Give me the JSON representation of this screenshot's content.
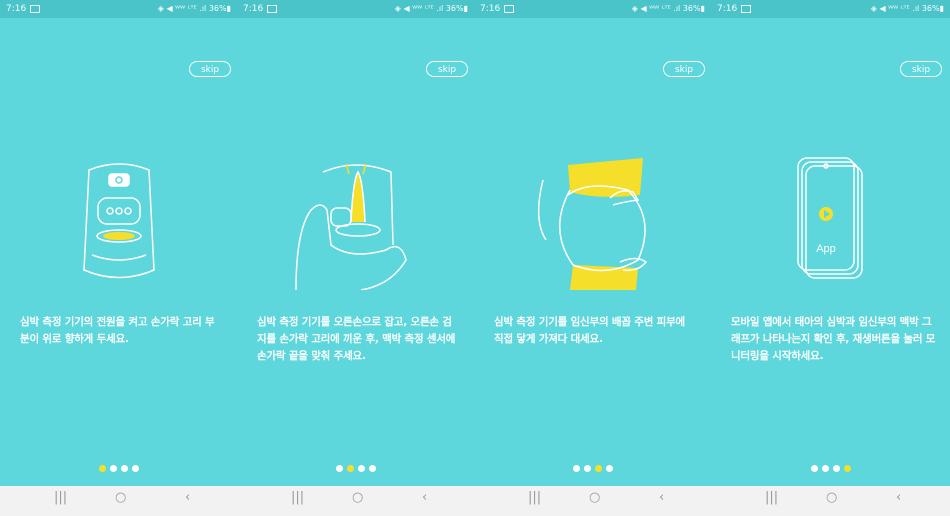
{
  "screens": [
    {
      "status_time": "7:16",
      "status_right": "◈ ◀ ᵂᵂ ᴸᵀᴱ .ıl 36%▮",
      "skip_label": "skip",
      "caption": "심박 측정 기기의 전원을 켜고 손가락 고리 부분이 위로 향하게 두세요.",
      "active_dot": 0,
      "illustration": "device-front",
      "nav": {
        "recent": "|||",
        "home": "○",
        "back": "‹"
      }
    },
    {
      "status_time": "7:16",
      "status_right": "◈ ◀ ᵂᵂ ᴸᵀᴱ .ıl 36%▮",
      "skip_label": "skip",
      "caption": "심박 측정 기기를 오른손으로 잡고, 오른손 검지를 손가락 고리에 끼운 후, 맥박 측정 센서에 손가락 끝을 맞춰 주세요.",
      "active_dot": 1,
      "illustration": "hand-holding-device",
      "nav": {
        "recent": "|||",
        "home": "○",
        "back": "‹"
      }
    },
    {
      "status_time": "7:16",
      "status_right": "◈ ◀ ᵂᵂ ᴸᵀᴱ .ıl 36%▮",
      "skip_label": "skip",
      "caption": "심박 측정 기기를 임신부의 배꼽 주변 피부에 직접 닿게 가져다 대세요.",
      "active_dot": 2,
      "illustration": "pregnant-belly",
      "nav": {
        "recent": "|||",
        "home": "○",
        "back": "‹"
      }
    },
    {
      "status_time": "7:16",
      "status_right": "◈ ◀ ᵂᵂ ᴸᵀᴱ .ıl 36%▮",
      "skip_label": "skip",
      "caption": "모바일 앱에서 태아의 심박과 임신부의 맥박 그래프가 나타나는지 확인 후, 재생버튼을 눌러 모니터링을 시작하세요.",
      "active_dot": 3,
      "illustration": "phone-app",
      "app_label": "App",
      "nav": {
        "recent": "|||",
        "home": "○",
        "back": "‹"
      }
    }
  ],
  "colors": {
    "background": "#5dd6dc",
    "accent": "#f6df2a",
    "statusbar": "#4ac3c9",
    "navbar": "#f2f2f2"
  }
}
